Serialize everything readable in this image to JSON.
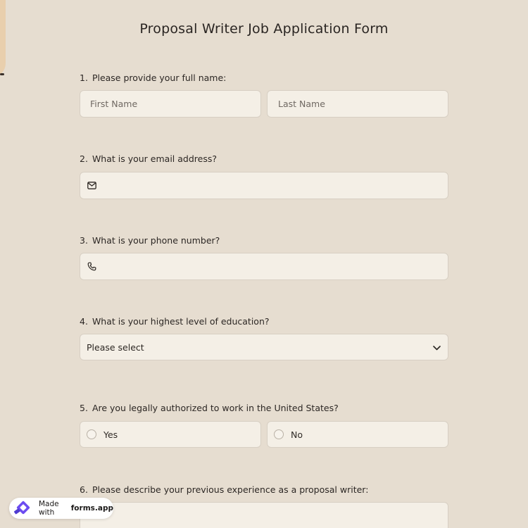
{
  "form": {
    "title": "Proposal Writer Job Application Form"
  },
  "questions": [
    {
      "num": "1.",
      "text": "Please provide your full name:"
    },
    {
      "num": "2.",
      "text": "What is your email address?"
    },
    {
      "num": "3.",
      "text": "What is your phone number?"
    },
    {
      "num": "4.",
      "text": "What is your highest level of education?"
    },
    {
      "num": "5.",
      "text": "Are you legally authorized to work in the United States?"
    },
    {
      "num": "6.",
      "text": "Please describe your previous experience as a proposal writer:"
    }
  ],
  "fields": {
    "first_name_placeholder": "First Name",
    "last_name_placeholder": "Last Name",
    "email_value": "",
    "phone_value": "",
    "education_selected": "Please select",
    "authorized_options": [
      "Yes",
      "No"
    ],
    "experience_value": ""
  },
  "badge": {
    "made_with": "Made with",
    "brand": "forms.app"
  },
  "icons": {
    "email": "envelope-icon",
    "phone": "phone-icon",
    "select": "chevron-down-icon",
    "brand": "forms-app-logo-icon"
  },
  "colors": {
    "background": "#e6ddd0",
    "field": "#f4efe6",
    "brand": "#6c4cf0"
  }
}
